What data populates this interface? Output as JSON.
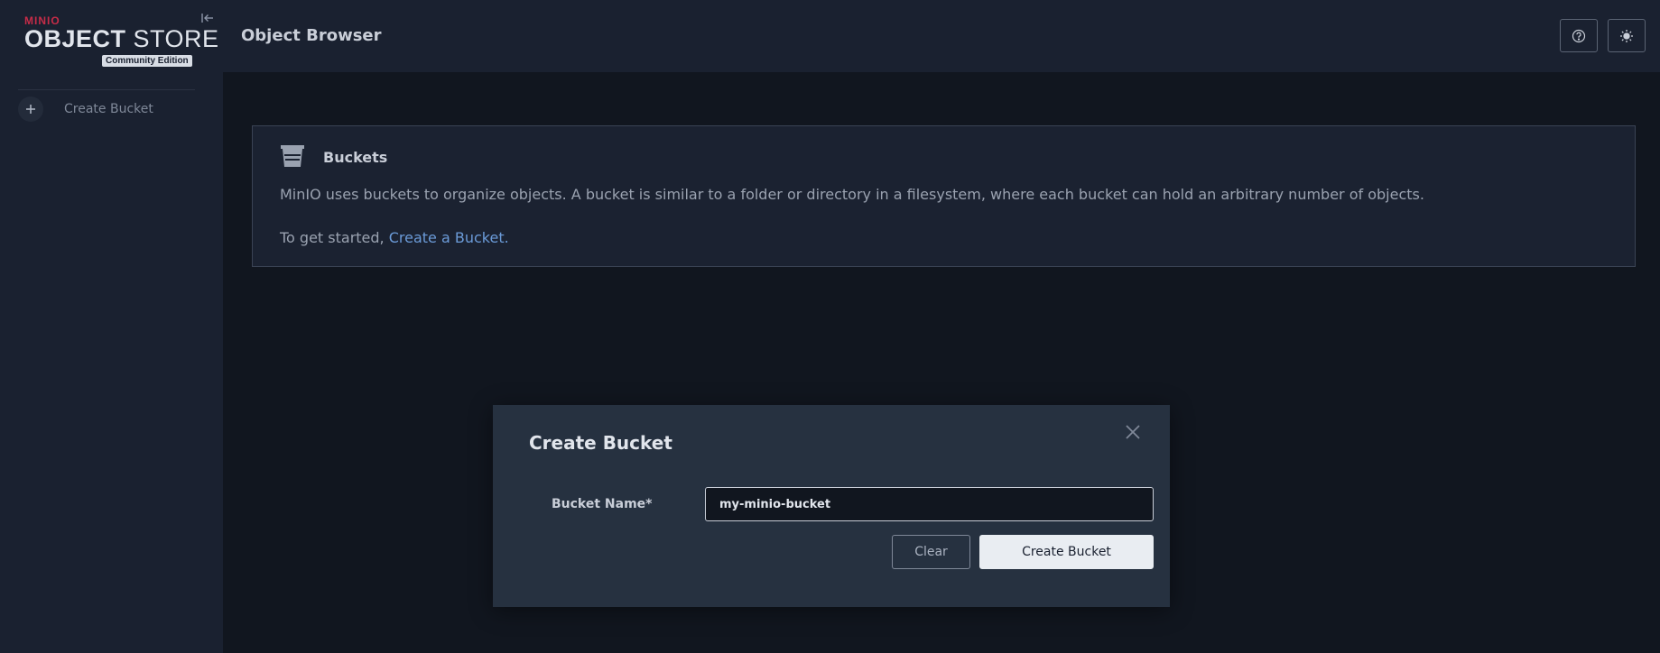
{
  "brand": {
    "minio": "MINIO",
    "title_bold": "OBJECT",
    "title_rest": " STORE",
    "edition": "Community Edition"
  },
  "sidebar": {
    "items": [
      {
        "label": "Create Bucket",
        "icon": "plus-icon"
      }
    ]
  },
  "header": {
    "title": "Object Browser",
    "buttons": [
      {
        "icon": "help-icon"
      },
      {
        "icon": "theme-toggle-icon"
      }
    ]
  },
  "info": {
    "icon": "bucket-icon",
    "title": "Buckets",
    "description": "MinIO uses buckets to organize objects. A bucket is similar to a folder or directory in a filesystem, where each bucket can hold an arbitrary number of objects.",
    "cta_prefix": "To get started, ",
    "cta_link": "Create a Bucket."
  },
  "modal": {
    "title": "Create Bucket",
    "field_label": "Bucket Name*",
    "field_value": "my-minio-bucket",
    "clear_label": "Clear",
    "create_label": "Create Bucket"
  },
  "colors": {
    "sidebar_bg": "#1a2130",
    "page_bg": "#11161f",
    "modal_bg": "#263140",
    "link": "#6b9bd8",
    "brand_red": "#c72c48"
  }
}
